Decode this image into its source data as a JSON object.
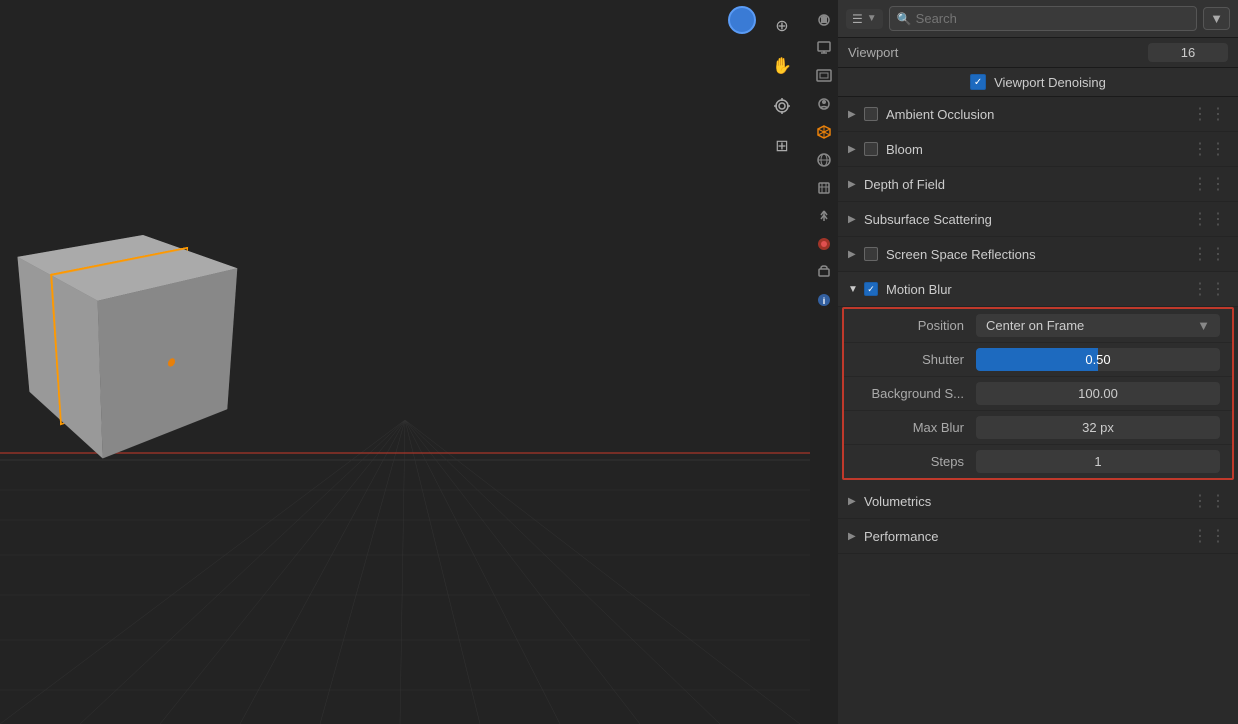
{
  "viewport": {
    "label": "3D Viewport"
  },
  "header": {
    "search_placeholder": "Search",
    "dropdown_label": "▼"
  },
  "properties": {
    "viewport_label": "Viewport",
    "viewport_value": "16",
    "denoising_label": "Viewport Denoising",
    "sections": [
      {
        "id": "ambient-occlusion",
        "label": "Ambient Occlusion",
        "arrow": "▶",
        "has_checkbox": true,
        "checked": false,
        "dots": "⋮⋮"
      },
      {
        "id": "bloom",
        "label": "Bloom",
        "arrow": "▶",
        "has_checkbox": true,
        "checked": false,
        "dots": "⋮⋮"
      },
      {
        "id": "depth-of-field",
        "label": "Depth of Field",
        "arrow": "▶",
        "has_checkbox": false,
        "checked": false,
        "dots": "⋮⋮"
      },
      {
        "id": "subsurface-scattering",
        "label": "Subsurface Scattering",
        "arrow": "▶",
        "has_checkbox": false,
        "checked": false,
        "dots": "⋮⋮"
      },
      {
        "id": "screen-space-reflections",
        "label": "Screen Space Reflections",
        "arrow": "▶",
        "has_checkbox": true,
        "checked": false,
        "dots": "⋮⋮"
      },
      {
        "id": "motion-blur",
        "label": "Motion Blur",
        "arrow": "▼",
        "has_checkbox": true,
        "checked": true,
        "dots": "⋮⋮"
      }
    ],
    "motion_blur": {
      "expanded": true,
      "position_label": "Position",
      "position_value": "Center on Frame",
      "shutter_label": "Shutter",
      "shutter_value": "0.50",
      "bg_scale_label": "Background S...",
      "bg_scale_value": "100.00",
      "max_blur_label": "Max Blur",
      "max_blur_value": "32 px",
      "steps_label": "Steps",
      "steps_value": "1"
    },
    "bottom_sections": [
      {
        "id": "volumetrics",
        "label": "Volumetrics",
        "arrow": "▶",
        "has_checkbox": false,
        "dots": "⋮⋮"
      },
      {
        "id": "performance",
        "label": "Performance",
        "arrow": "▶",
        "has_checkbox": false,
        "dots": "⋮⋮"
      }
    ]
  },
  "sidebar_icons": [
    {
      "id": "scene",
      "symbol": "🎬",
      "active": false
    },
    {
      "id": "render",
      "symbol": "🖨",
      "active": false
    },
    {
      "id": "output",
      "symbol": "🖼",
      "active": false
    },
    {
      "id": "view-layer",
      "symbol": "👤",
      "active": false
    },
    {
      "id": "scene2",
      "symbol": "🎭",
      "active": true
    },
    {
      "id": "world",
      "symbol": "🌐",
      "active": false
    },
    {
      "id": "object",
      "symbol": "🔧",
      "active": false
    },
    {
      "id": "particles",
      "symbol": "✳",
      "active": false
    },
    {
      "id": "physics",
      "symbol": "🔴",
      "active": false
    },
    {
      "id": "constraints",
      "symbol": "⬛",
      "active": false
    },
    {
      "id": "data",
      "symbol": "🔵",
      "active": false
    }
  ],
  "toolbar_icons": [
    {
      "id": "zoom",
      "symbol": "⊕"
    },
    {
      "id": "pan",
      "symbol": "✋"
    },
    {
      "id": "camera",
      "symbol": "🎥"
    },
    {
      "id": "grid",
      "symbol": "⊞"
    }
  ]
}
